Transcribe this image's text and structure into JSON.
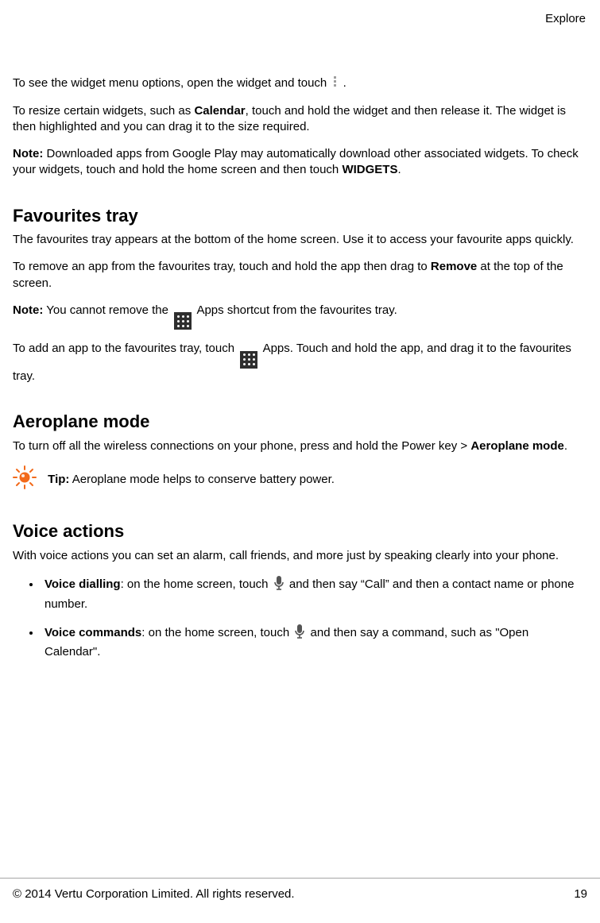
{
  "header": {
    "section": "Explore"
  },
  "p1": {
    "a": "To see the widget menu options, open the widget and touch ",
    "b": " ."
  },
  "p2": {
    "a": "To resize certain widgets, such as ",
    "b": "Calendar",
    "c": ", touch and hold the widget and then release it. The widget is then highlighted and you can drag it to the size required."
  },
  "p3": {
    "a": "Note:",
    "b": " Downloaded apps from Google Play may automatically download other associated widgets. To check your widgets, touch and hold the home screen and then touch ",
    "c": "WIDGETS",
    "d": "."
  },
  "h_fav": "Favourites tray",
  "p4": "The favourites tray appears at the bottom of the home screen. Use it to access your favourite apps quickly.",
  "p5": {
    "a": "To remove an app from the favourites tray, touch and hold the app then drag to ",
    "b": "Remove",
    "c": " at the top of the screen."
  },
  "p6": {
    "a": "Note:",
    "b": " You cannot remove the ",
    "c": " Apps shortcut from the favourites tray."
  },
  "p7": {
    "a": "To add an app to the favourites tray, touch ",
    "b": " Apps. Touch and hold the app, and drag it to the favourites tray."
  },
  "h_aero": "Aeroplane mode",
  "p8": {
    "a": "To turn off all the wireless connections on your phone, press and hold the Power key > ",
    "b": "Aeroplane mode",
    "c": "."
  },
  "tip": {
    "label": "Tip:",
    "text": " Aeroplane mode helps to conserve battery power."
  },
  "h_voice": "Voice actions",
  "p9": "With voice actions you can set an alarm, call friends, and more just by speaking clearly into your phone.",
  "li1": {
    "a": "Voice dialling",
    "b": ": on the home screen, touch ",
    "c": " and then say “Call” and then a contact name or phone number."
  },
  "li2": {
    "a": "Voice commands",
    "b": ": on the home screen, touch ",
    "c": " and then say a command, such as \"Open Calendar\"."
  },
  "footer": {
    "copyright": "© 2014 Vertu Corporation Limited. All rights reserved.",
    "page": "19"
  }
}
